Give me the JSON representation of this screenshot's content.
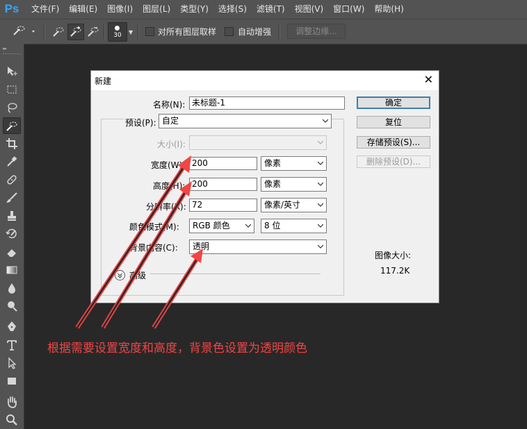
{
  "app": {
    "logo": "Ps"
  },
  "menu": [
    "文件(F)",
    "编辑(E)",
    "图像(I)",
    "图层(L)",
    "类型(Y)",
    "选择(S)",
    "滤镜(T)",
    "视图(V)",
    "窗口(W)",
    "帮助(H)"
  ],
  "options_bar": {
    "brush_size": "30",
    "sample_all_layers_label": "对所有图层取样",
    "auto_enhance_label": "自动增强",
    "refine_edge_label": "调整边缘..."
  },
  "tools": [
    "move-icon",
    "rect-marquee-icon",
    "lasso-icon",
    "quick-selection-icon",
    "crop-icon",
    "eyedropper-icon",
    "healing-brush-icon",
    "brush-icon",
    "clone-stamp-icon",
    "history-brush-icon",
    "eraser-icon",
    "gradient-icon",
    "blur-icon",
    "dodge-icon",
    "pen-icon",
    "type-icon",
    "path-selection-icon",
    "rectangle-icon",
    "hand-icon",
    "zoom-icon"
  ],
  "dialog": {
    "title": "新建",
    "close": "✕",
    "name_label": "名称(N):",
    "name_value": "未标题-1",
    "preset_label": "预设(P):",
    "preset_value": "自定",
    "size_label": "大小(I):",
    "size_value": "",
    "width_label": "宽度(W):",
    "width_value": "200",
    "width_unit": "像素",
    "height_label": "高度(H):",
    "height_value": "200",
    "height_unit": "像素",
    "resolution_label": "分辨率(R):",
    "resolution_value": "72",
    "resolution_unit": "像素/英寸",
    "color_mode_label": "颜色模式(M):",
    "color_mode_value": "RGB 颜色",
    "bit_depth_value": "8 位",
    "background_label": "背景内容(C):",
    "background_value": "透明",
    "advanced_label": "高级",
    "ok_label": "确定",
    "reset_label": "复位",
    "save_preset_label": "存储预设(S)...",
    "delete_preset_label": "删除预设(D)...",
    "image_size_label": "图像大小:",
    "image_size_value": "117.2K"
  },
  "annotation": {
    "text": "根据需要设置宽度和高度，背景色设置为透明颜色",
    "color": "#f24545"
  },
  "colors": {
    "menubar": "#535353",
    "canvas": "#282828",
    "accent": "#3c7fb1"
  }
}
